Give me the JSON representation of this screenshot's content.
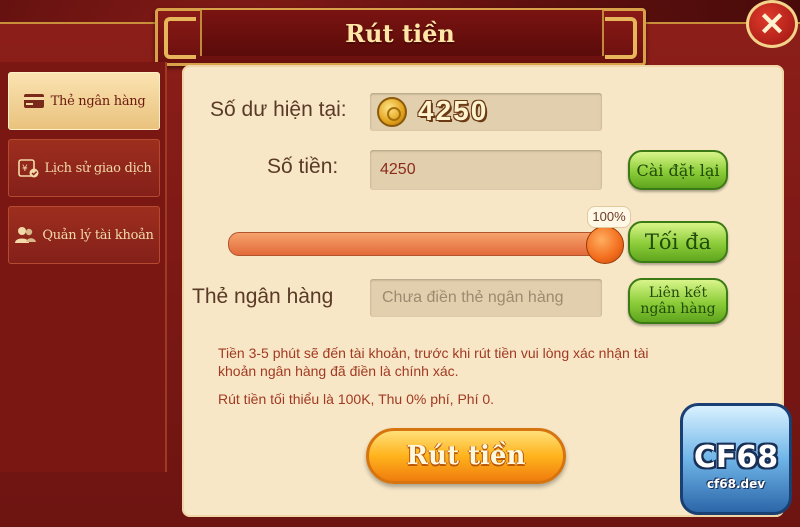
{
  "dialog": {
    "title": "Rút tiền",
    "close_symbol": "✕"
  },
  "sidebar": {
    "items": [
      {
        "label": "Thẻ ngân hàng",
        "icon": "bank-card-icon",
        "active": true
      },
      {
        "label": "Lịch sử giao dịch",
        "icon": "transaction-history-icon",
        "active": false
      },
      {
        "label": "Quản lý tài khoản",
        "icon": "account-users-icon",
        "active": false
      }
    ]
  },
  "form": {
    "balance_label": "Số dư hiện tại:",
    "balance_value": "4250",
    "amount_label": "Số tiền:",
    "amount_value": "4250",
    "reset_button": "Cài đặt lại",
    "slider_percent_label": "100%",
    "slider_value": 1.0,
    "max_button": "Tối đa",
    "bank_card_label": "Thẻ ngân hàng",
    "bank_card_placeholder": "Chưa điền thẻ ngân hàng",
    "link_bank_button_line1": "Liên kết",
    "link_bank_button_line2": "ngân hàng",
    "note_line1": "Tiền 3-5 phút sẽ đến tài khoản, trước khi rút tiền vui lòng xác nhận tài",
    "note_line2": "khoản ngân hàng đã điền là chính xác.",
    "note_line3": "Rút tiền tối thiểu là 100K, Thu 0% phí, Phí 0.",
    "withdraw_button": "Rút tiền"
  },
  "watermark": {
    "brand": "CF68",
    "site": "cf68.dev"
  },
  "colors": {
    "accent_gold": "#d9a24a",
    "panel_bg": "#f7e7c7",
    "button_green": "#8bcc38",
    "button_orange": "#ffb31c"
  }
}
